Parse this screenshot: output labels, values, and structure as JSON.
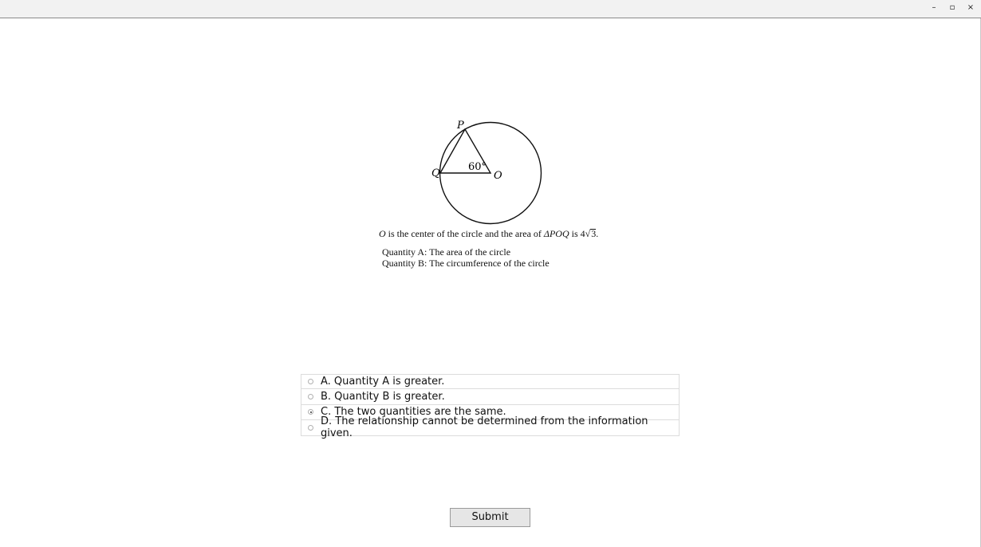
{
  "window": {
    "controls": [
      "–",
      "▫",
      "×"
    ]
  },
  "figure": {
    "labels": {
      "p": "P",
      "q": "Q",
      "o": "O",
      "angle": "60°"
    }
  },
  "question": {
    "statement_parts": {
      "o": "O",
      "text1": " is the center of the circle and the area of ",
      "triangle": "ΔPOQ",
      "text2": " is 4",
      "sqrt_sign": "√",
      "radicand": "3",
      "end": "."
    },
    "quantity_a": "Quantity A: The area of the circle",
    "quantity_b": "Quantity B: The circumference of the circle"
  },
  "options": [
    {
      "label": "A. Quantity A is greater.",
      "selected": false
    },
    {
      "label": "B. Quantity B is greater.",
      "selected": false
    },
    {
      "label": "C. The two quantities are the same.",
      "selected": true
    },
    {
      "label": "D. The relationship cannot be determined from the information given.",
      "selected": false
    }
  ],
  "submit_label": "Submit"
}
